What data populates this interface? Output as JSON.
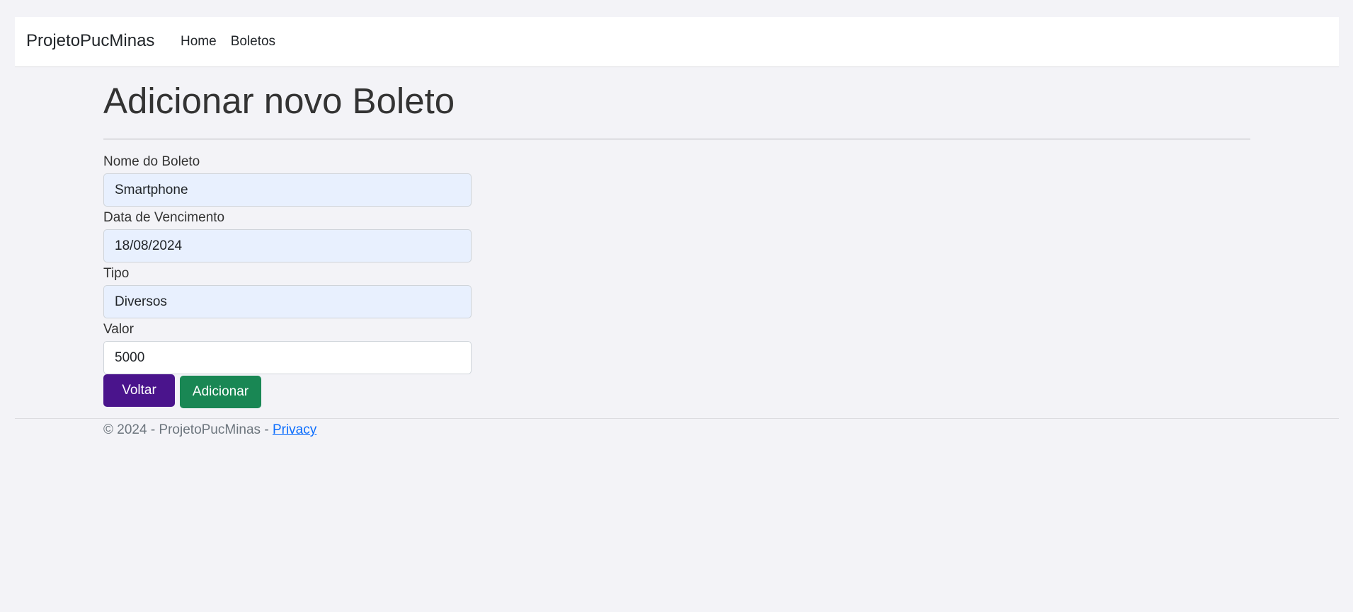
{
  "navbar": {
    "brand": "ProjetoPucMinas",
    "links": [
      {
        "label": "Home"
      },
      {
        "label": "Boletos"
      }
    ]
  },
  "main": {
    "title": "Adicionar novo Boleto",
    "form": {
      "fields": [
        {
          "label": "Nome do Boleto",
          "value": "Smartphone"
        },
        {
          "label": "Data de Vencimento",
          "value": "18/08/2024"
        },
        {
          "label": "Tipo",
          "value": "Diversos"
        },
        {
          "label": "Valor",
          "value": "5000"
        }
      ],
      "back_label": "Voltar",
      "submit_label": "Adicionar"
    }
  },
  "footer": {
    "text": "© 2024 - ProjetoPucMinas - ",
    "link_label": "Privacy"
  },
  "colors": {
    "page_background": "#f3f3f7",
    "back_button": "#4a148c",
    "submit_button": "#198754",
    "autofill_input": "#e8f0fe",
    "link": "#0d6efd"
  }
}
